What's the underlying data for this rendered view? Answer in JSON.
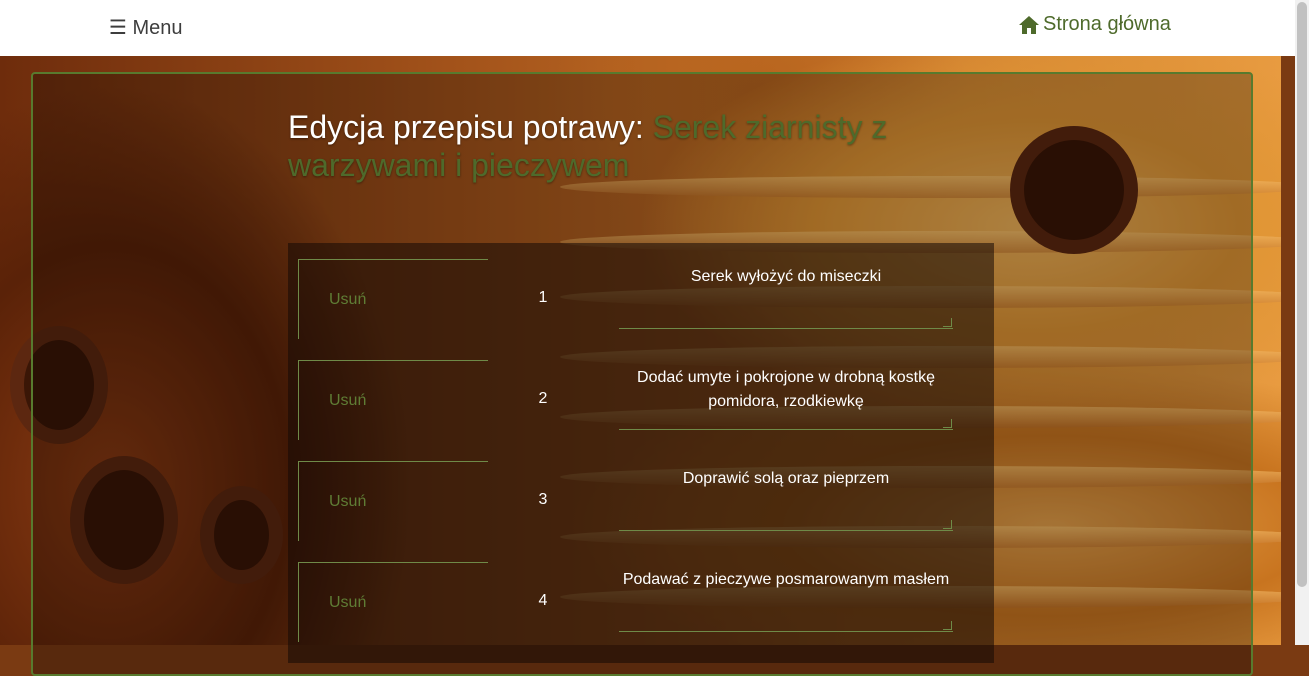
{
  "nav": {
    "menu_label": "☰ Menu",
    "home_label": "Strona główna"
  },
  "page": {
    "title_prefix": "Edycja przepisu potrawy: ",
    "dish_name": "Serek ziarnisty z warzywami i pieczywem"
  },
  "steps": [
    {
      "delete_label": "Usuń",
      "number": "1",
      "text": "Serek wyłożyć do miseczki"
    },
    {
      "delete_label": "Usuń",
      "number": "2",
      "text": "Dodać umyte i pokrojone w drobną kostkę pomidora, rzodkiewkę"
    },
    {
      "delete_label": "Usuń",
      "number": "3",
      "text": "Doprawić solą oraz pieprzem"
    },
    {
      "delete_label": "Usuń",
      "number": "4",
      "text": "Podawać z pieczywe posmarowanym masłem"
    }
  ],
  "colors": {
    "accent": "#4e6a2b",
    "border": "#587a2e"
  }
}
